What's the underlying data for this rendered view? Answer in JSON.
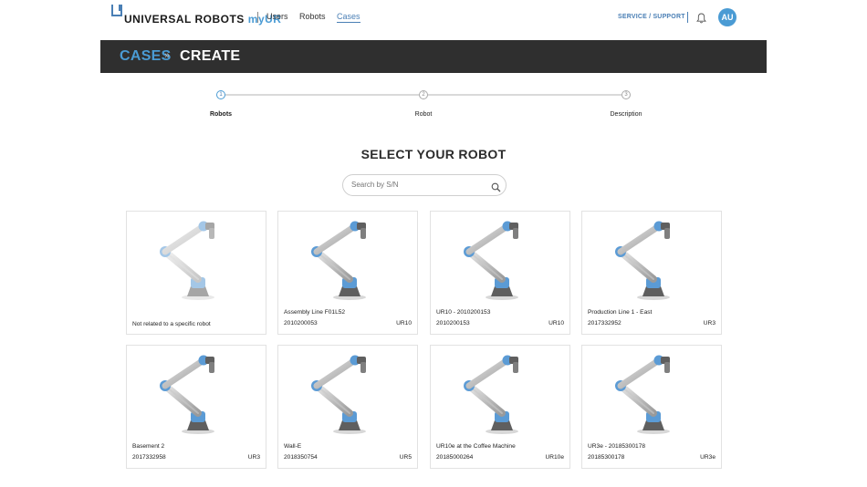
{
  "brand": {
    "name": "UNIVERSAL ROBOTS",
    "suffix": "myUR",
    "color": "#4a9bd4"
  },
  "nav": {
    "items": [
      {
        "label": "Users"
      },
      {
        "label": "Robots"
      },
      {
        "label": "Cases",
        "active": true
      }
    ],
    "service_label": "SERVICE / SUPPORT",
    "bell_icon": "bell-icon",
    "avatar_initials": "AU"
  },
  "header": {
    "breadcrumb_parent": "CASES",
    "breadcrumb_separator": "»",
    "breadcrumb_current": "CREATE"
  },
  "stepper": {
    "steps": [
      {
        "number": "1",
        "label": "Robots",
        "active": true
      },
      {
        "number": "2",
        "label": "Robot",
        "active": false
      },
      {
        "number": "3",
        "label": "Description",
        "active": false
      }
    ]
  },
  "main": {
    "title": "SELECT YOUR ROBOT",
    "search": {
      "placeholder": "Search by S/N",
      "icon": "search-icon"
    }
  },
  "cards": [
    {
      "name": "Not related to a specific robot",
      "serial": "",
      "model": "",
      "faded": true
    },
    {
      "name": "Assembly Line F01L52",
      "serial": "2010200053",
      "model": "UR10"
    },
    {
      "name": "UR10 - 2010200153",
      "serial": "2010200153",
      "model": "UR10"
    },
    {
      "name": "Production Line 1 - East",
      "serial": "2017332952",
      "model": "UR3"
    },
    {
      "name": "Basement 2",
      "serial": "2017332958",
      "model": "UR3"
    },
    {
      "name": "Wall-E",
      "serial": "2018350754",
      "model": "UR5"
    },
    {
      "name": "UR10e at the Coffee Machine",
      "serial": "20185000264",
      "model": "UR10e"
    },
    {
      "name": "UR3e - 20185300178",
      "serial": "20185300178",
      "model": "UR3e"
    }
  ],
  "colors": {
    "accent": "#4a9bd4",
    "link": "#4a7fb5",
    "header_band": "#2f2f2f",
    "robot_joint": "#5b9bd5",
    "robot_arm": "#c9c9c9"
  }
}
